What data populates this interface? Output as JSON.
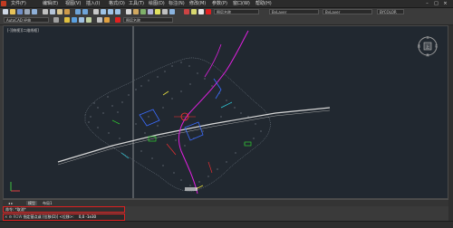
{
  "menubar": {
    "items": [
      "文件(F)",
      "编辑(E)",
      "视图(V)",
      "插入(I)",
      "格式(O)",
      "工具(T)",
      "绘图(D)",
      "标注(N)",
      "修改(M)",
      "参数(P)",
      "窗口(W)",
      "帮助(H)"
    ],
    "window_controls": [
      "–",
      "□",
      "×"
    ]
  },
  "toolbar": {
    "workspace": "AutoCAD 经典",
    "layer_combo": "ByLayer",
    "linetype_combo": "ByLayer",
    "lineweight_combo": "ByLayer",
    "color_combo": "BYCOLOR",
    "layer_name": "图层名称"
  },
  "viewport": {
    "label": "[-][俯视][二维线框]"
  },
  "viewcube": {
    "label": "上",
    "compass": [
      "北",
      "东",
      "南",
      "西"
    ]
  },
  "tabs": [
    "模型",
    "布局1"
  ],
  "command": {
    "history": "命令: *取消*",
    "prompt_icon": "ROW",
    "prompt_text": "指定基点或 [位移(D)] <位移>:",
    "value": "0,0 -1e30"
  },
  "colors": {
    "background": "#212830",
    "accent": "#e02020"
  }
}
